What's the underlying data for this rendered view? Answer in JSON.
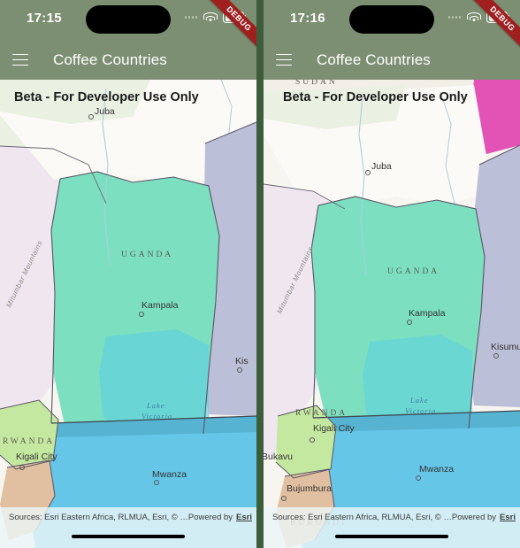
{
  "screenshot": {
    "description": "Side-by-side comparison of two mobile screenshots of the Coffee Countries map app",
    "panels": 2,
    "divider_color": "#3d5c3a"
  },
  "theme": {
    "appbar_color": "#7d8f72",
    "appbar_text_color": "#ffffff",
    "debug_ribbon_color": "#a02020",
    "uganda_fill": "#7fe3c2",
    "rwanda_fill": "#c5e8a0",
    "burundi_fill": "#e0c0a0",
    "kenya_fill": "#b9bcd6",
    "ethiopia_fill": "#e352b5",
    "water_fill": "#66c6e8",
    "land_fill": "#f6f4ef",
    "attribution_bg": "#ecf5f8"
  },
  "left_panel": {
    "status_bar": {
      "time": "17:15",
      "signal_icon": "signal-dots-icon",
      "wifi_icon": "wifi-icon",
      "battery_icon": "battery-icon"
    },
    "debug_ribbon_label": "DEBUG",
    "app_bar": {
      "menu_icon": "hamburger-menu-icon",
      "title": "Coffee Countries"
    },
    "map": {
      "beta_banner": "Beta - For Developer Use Only",
      "country_labels": [
        "UGANDA",
        "RWANDA"
      ],
      "city_labels": [
        "Juba",
        "Kampala",
        "Kigali City",
        "Mwanza",
        "Kis"
      ],
      "water_labels": [
        "Lake Victoria"
      ],
      "terrain_labels": [
        "Mitumbar Mountains"
      ],
      "highlighted_country": "UGANDA"
    },
    "attribution": {
      "sources": "Sources: Esri Eastern Africa, RLMUA, Esri, © …",
      "powered_by": "Powered by",
      "provider": "Esri"
    }
  },
  "right_panel": {
    "status_bar": {
      "time": "17:16",
      "signal_icon": "signal-dots-icon",
      "wifi_icon": "wifi-icon",
      "battery_icon": "battery-icon"
    },
    "debug_ribbon_label": "DEBUG",
    "app_bar": {
      "menu_icon": "hamburger-menu-icon",
      "title": "Coffee Countries"
    },
    "map": {
      "beta_banner": "Beta - For Developer Use Only",
      "country_labels": [
        "SUDAN",
        "UGANDA",
        "RWANDA",
        "BURUNDI"
      ],
      "city_labels": [
        "Juba",
        "Kampala",
        "Kisumu",
        "Kigali City",
        "Bukavu",
        "Bujumbura",
        "Mwanza"
      ],
      "water_labels": [
        "Lake Victoria"
      ],
      "terrain_labels": [
        "Mitumbar Mountains"
      ],
      "highlighted_country": "UGANDA"
    },
    "attribution": {
      "sources": "Sources: Esri Eastern Africa, RLMUA, Esri, © …",
      "powered_by": "Powered by",
      "provider": "Esri"
    }
  }
}
